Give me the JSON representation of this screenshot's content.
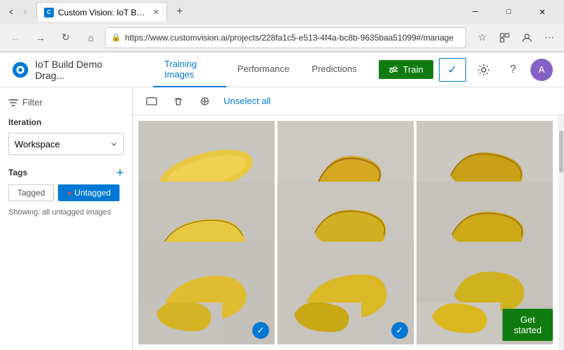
{
  "browser": {
    "tab_title": "Custom Vision: IoT Buil...",
    "url": "https://www.customvision.ai/projects/228fa1c5-e513-4f4a-bc8b-9635baa51099#/manage",
    "favicon_text": "C"
  },
  "app": {
    "title": "IoT Build Demo Drag...",
    "nav_items": [
      {
        "label": "Training Images",
        "active": true
      },
      {
        "label": "Performance",
        "active": false
      },
      {
        "label": "Predictions",
        "active": false
      }
    ],
    "train_label": "Train",
    "checkmark_label": "✓",
    "avatar_initials": "A"
  },
  "sidebar": {
    "filter_label": "Filter",
    "iteration_label": "Iteration",
    "workspace_value": "Workspace",
    "tags_label": "Tags",
    "add_tag_label": "+",
    "tag_tagged": "Tagged",
    "tag_untagged": "Untagged",
    "untagged_dot": "●",
    "showing_text": "Showing: all untagged images"
  },
  "toolbar": {
    "unselect_label": "Unselect all"
  },
  "images": [
    {
      "id": 1,
      "checked": false,
      "row": 0
    },
    {
      "id": 2,
      "checked": false,
      "row": 0
    },
    {
      "id": 3,
      "checked": false,
      "row": 0
    },
    {
      "id": 4,
      "checked": false,
      "row": 1
    },
    {
      "id": 5,
      "checked": false,
      "row": 1
    },
    {
      "id": 6,
      "checked": true,
      "hover": true,
      "row": 1
    },
    {
      "id": 7,
      "checked": true,
      "row": 2
    },
    {
      "id": 8,
      "checked": true,
      "row": 2
    },
    {
      "id": 9,
      "checked": false,
      "row": 2
    },
    {
      "id": 10,
      "checked": false,
      "row": 3
    },
    {
      "id": 11,
      "checked": false,
      "row": 3
    },
    {
      "id": 12,
      "checked": false,
      "row": 3
    }
  ],
  "get_started_label": "Get started"
}
